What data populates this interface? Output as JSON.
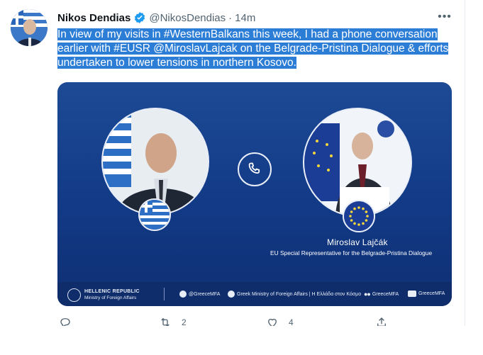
{
  "tweet": {
    "display_name": "Nikos Dendias",
    "handle": "@NikosDendias",
    "separator": "·",
    "time": "14m",
    "more_label": "•••",
    "text": "In view of my visits in #WesternBalkans this week, I had a phone conversation earlier with #EUSR @MiroslavLajcak on the Belgrade-Pristina Dialogue & efforts undertaken to lower tensions in northern Kosovo."
  },
  "card": {
    "person_name": "Miroslav Lajčák",
    "person_role": "EU Special Representative for the Belgrade-Pristina Dialogue",
    "gov_name": "HELLENIC REPUBLIC",
    "gov_ministry": "Ministry of Foreign Affairs",
    "social_twitter": "@GreeceMFA",
    "social_facebook": "Greek Ministry of Foreign Affairs | Η Ελλάδα στον Κόσμο",
    "social_flickr": "GreeceMFA",
    "social_youtube": "GreeceMFA"
  },
  "actions": {
    "retweet_count": "2",
    "like_count": "4"
  },
  "colors": {
    "selection": "#2c7dd6",
    "card_blue": "#123a86",
    "verified": "#1d9bf0"
  },
  "icons": [
    "verified-badge-icon",
    "more-icon",
    "phone-icon",
    "greek-flag-icon",
    "eu-flag-icon",
    "twitter-icon",
    "facebook-icon",
    "flickr-icon",
    "youtube-icon",
    "reply-icon",
    "retweet-icon",
    "like-icon",
    "share-icon"
  ]
}
